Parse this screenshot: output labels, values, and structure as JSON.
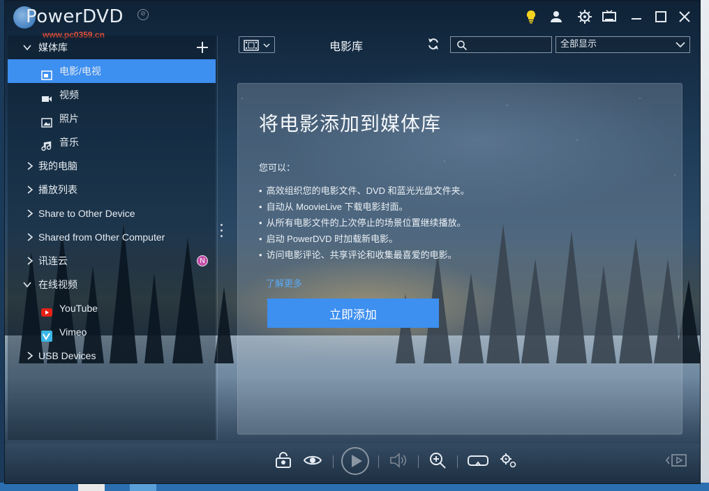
{
  "app": {
    "title": "PowerDVD",
    "watermark_text": "www.pc0359.cn"
  },
  "titlebar": {
    "icons": [
      "lightbulb-icon",
      "user-icon",
      "gear-icon",
      "tv-mode-icon",
      "minimize-icon",
      "maximize-icon",
      "close-icon"
    ]
  },
  "sidebar": {
    "items": [
      {
        "label": "媒体库",
        "expanded": true,
        "level": 0
      },
      {
        "label": "电影/电视",
        "icon": "movie-icon",
        "level": 1,
        "selected": true
      },
      {
        "label": "视频",
        "icon": "video-camera-icon",
        "level": 1
      },
      {
        "label": "照片",
        "icon": "photo-icon",
        "level": 1
      },
      {
        "label": "音乐",
        "icon": "music-note-icon",
        "level": 1
      },
      {
        "label": "我的电脑",
        "level": 0
      },
      {
        "label": "播放列表",
        "level": 0
      },
      {
        "label": "Share to Other Device",
        "level": 0
      },
      {
        "label": "Shared from Other Computer",
        "level": 0
      },
      {
        "label": "讯连云",
        "level": 0,
        "badge": "N"
      },
      {
        "label": "在线视频",
        "expanded": true,
        "level": 0
      },
      {
        "label": "YouTube",
        "icon": "youtube-icon",
        "level": 1
      },
      {
        "label": "Vimeo",
        "icon": "vimeo-icon",
        "level": 1
      },
      {
        "label": "USB Devices",
        "level": 0
      }
    ]
  },
  "toolbar": {
    "library_title": "电影库",
    "search_placeholder": "",
    "filter_selected": "全部显示"
  },
  "panel": {
    "heading": "将电影添加到媒体库",
    "intro": "您可以：",
    "bullets": [
      "高效组织您的电影文件、DVD 和蓝光光盘文件夹。",
      "自动从 MoovieLive 下载电影封面。",
      "从所有电影文件的上次停止的场景位置继续播放。",
      "启动 PowerDVD 时加载新电影。",
      "访问电影评论、共享评论和收集最喜爱的电影。"
    ],
    "learn_more": "了解更多",
    "add_button": "立即添加"
  },
  "controls": {
    "icons": [
      "snapshot-lock-icon",
      "eye-icon",
      "play-icon",
      "volume-icon",
      "zoom-in-icon",
      "vr-headset-icon",
      "settings-icon",
      "expand-panel-icon"
    ]
  },
  "colors": {
    "accent": "#3d8ff0",
    "link": "#5aaaf5",
    "badge": "#c44ea8"
  }
}
